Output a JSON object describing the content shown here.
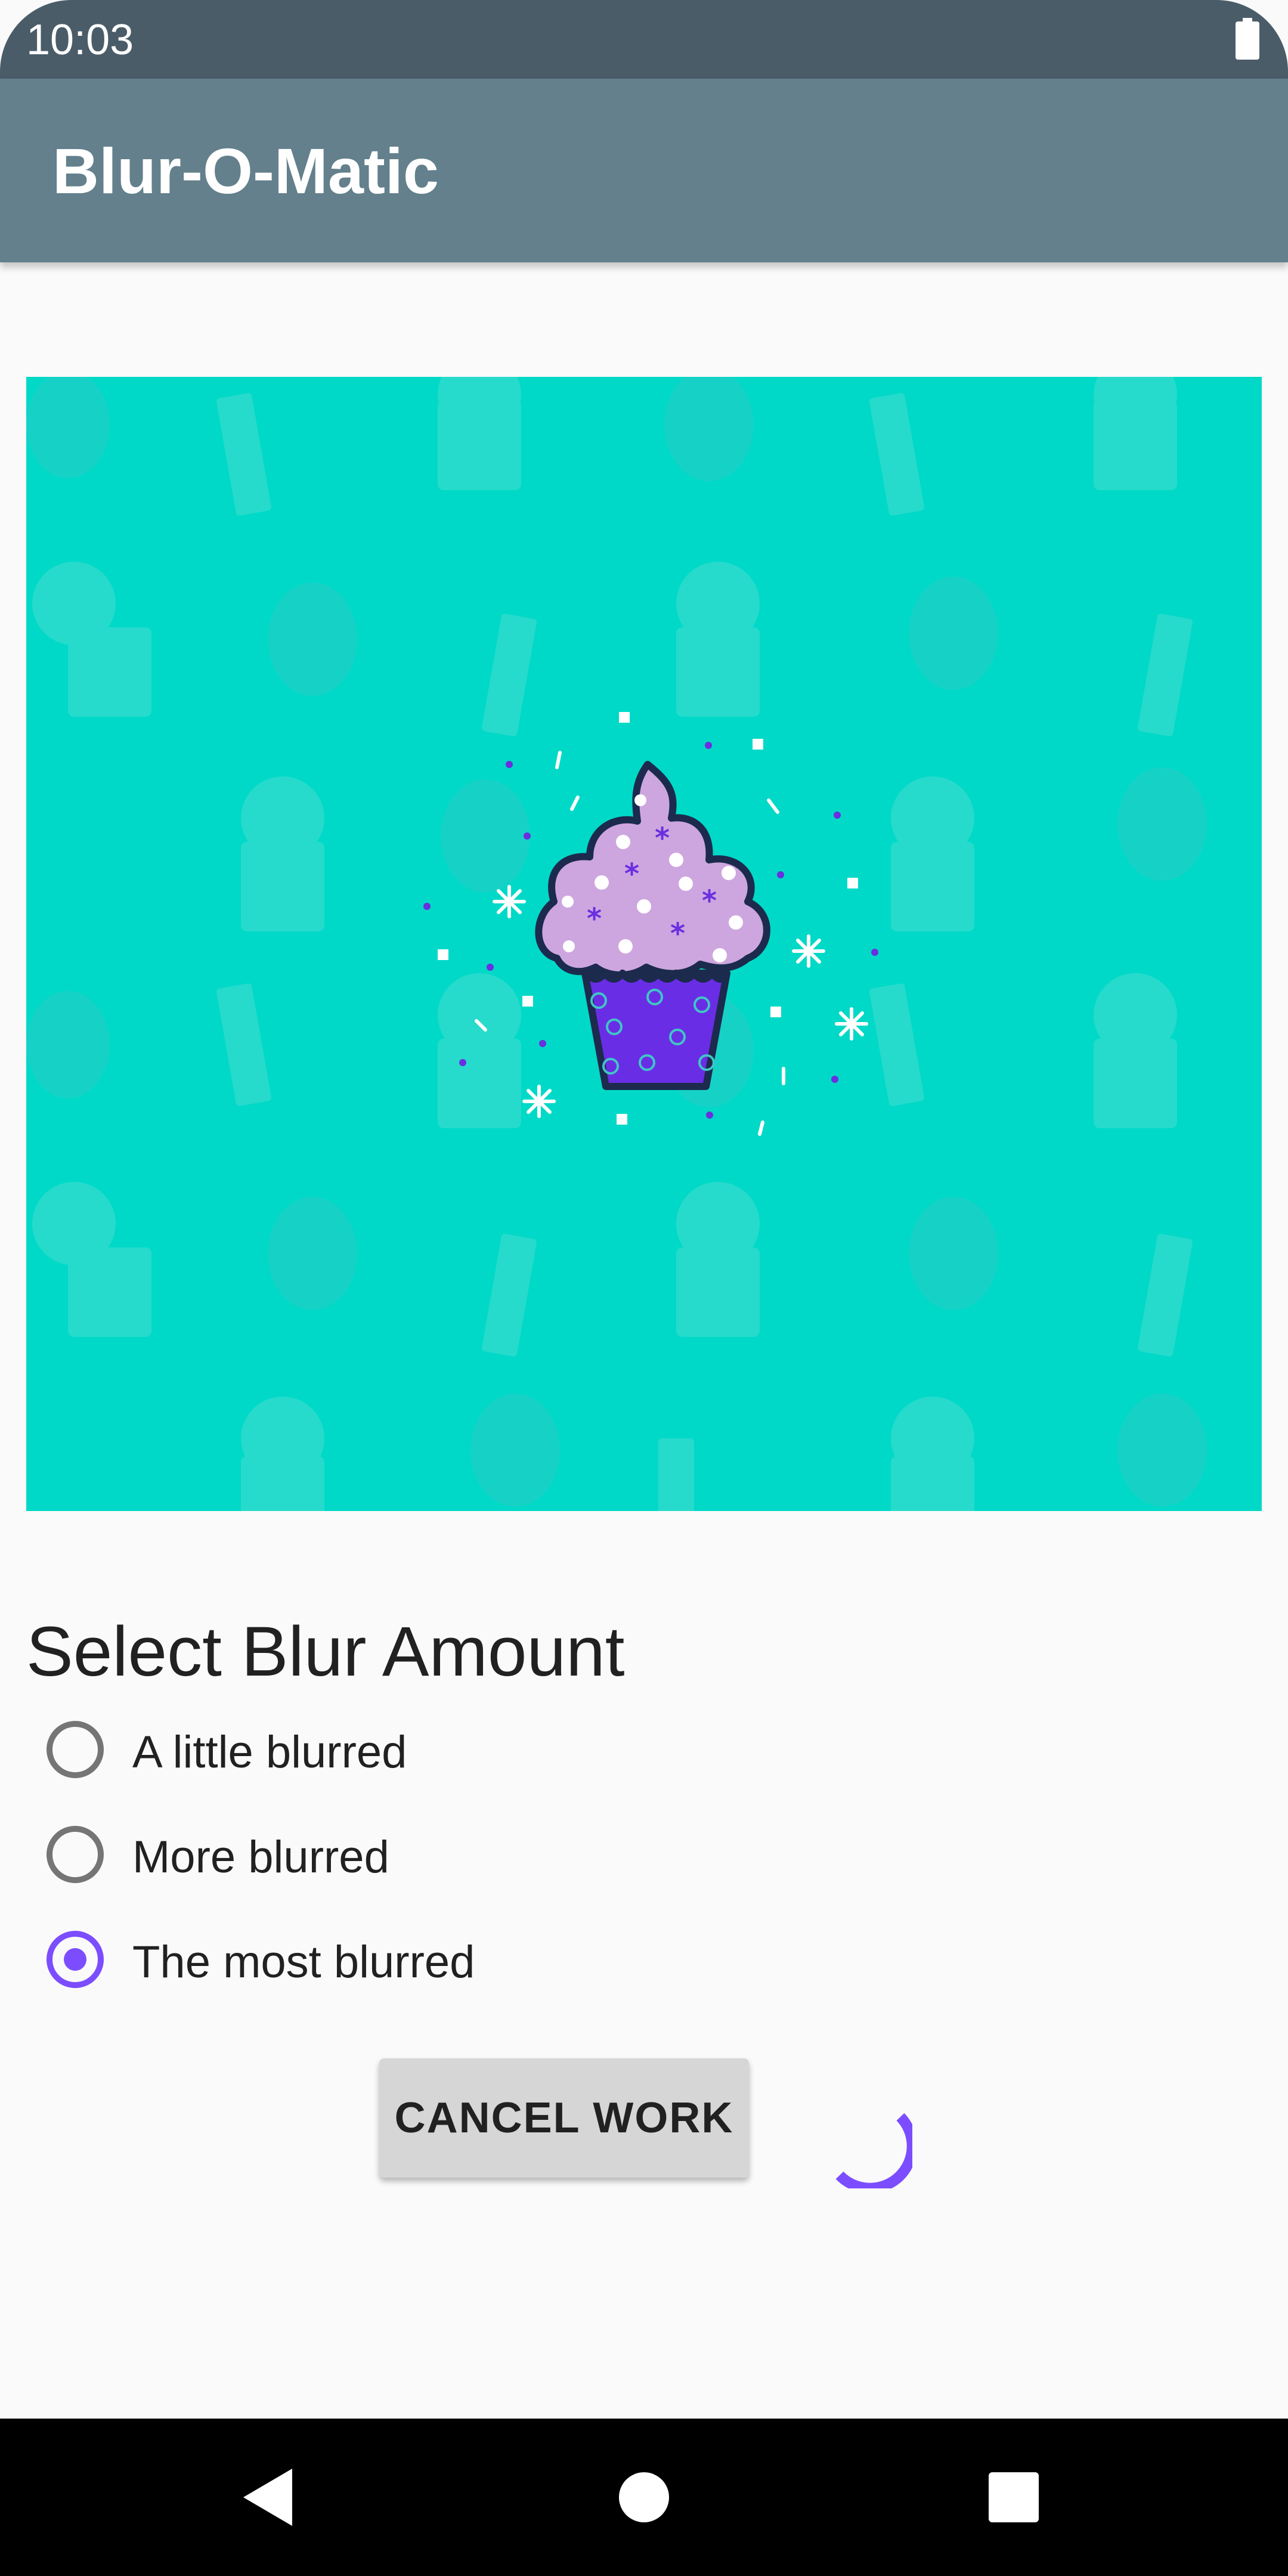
{
  "status_bar": {
    "time": "10:03"
  },
  "app_bar": {
    "title": "Blur-O-Matic"
  },
  "image": {
    "description_icon": "cupcake-image",
    "background_color": "#00d9c7"
  },
  "blur_section": {
    "heading": "Select Blur Amount",
    "options": [
      {
        "label": "A little blurred",
        "selected": false
      },
      {
        "label": "More blurred",
        "selected": false
      },
      {
        "label": "The most blurred",
        "selected": true
      }
    ]
  },
  "actions": {
    "cancel_label": "CANCEL WORK",
    "progress_icon": "loading-spinner-icon"
  },
  "nav_bar": {
    "back_icon": "back-icon",
    "home_icon": "home-icon",
    "recents_icon": "recents-icon"
  },
  "colors": {
    "status_bar": "#4a5c68",
    "app_bar": "#63808c",
    "accent": "#7c4dff",
    "image_bg": "#00d9c7"
  }
}
